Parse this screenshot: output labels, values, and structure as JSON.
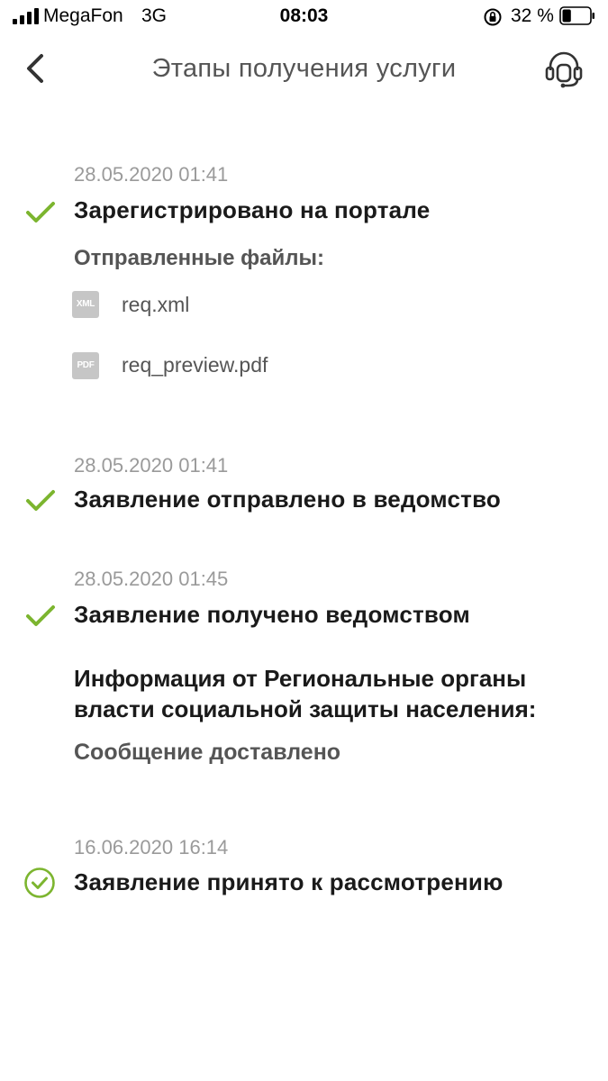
{
  "status_bar": {
    "carrier": "MegaFon",
    "network": "3G",
    "time": "08:03",
    "battery_text": "32 %",
    "battery_level": 0.32
  },
  "header": {
    "title": "Этапы получения услуги",
    "back_icon": "chevron-left-icon",
    "support_icon": "headset-icon"
  },
  "colors": {
    "accent_green": "#7cb52f",
    "date_gray": "#9a9a9a",
    "text_dark": "#1a1a1a",
    "text_gray": "#555555",
    "file_icon_gray": "#c6c6c6"
  },
  "stages": [
    {
      "date": "28.05.2020 01:41",
      "title": "Зарегистрировано на портале",
      "files_label": "Отправленные файлы:",
      "files": [
        {
          "badge": "XML",
          "name": "req.xml"
        },
        {
          "badge": "PDF",
          "name": "req_preview.pdf"
        }
      ]
    },
    {
      "date": "28.05.2020 01:41",
      "title": "Заявление отправлено в ведомство"
    },
    {
      "date": "28.05.2020 01:45",
      "title": "Заявление получено ведомством",
      "info_title": "Информация от Региональные органы власти социальной защиты населения:",
      "info_text": "Сообщение доставлено"
    },
    {
      "date": "16.06.2020 16:14",
      "title": "Заявление принято к рассмотрению",
      "icon": "check-circle-icon"
    }
  ]
}
